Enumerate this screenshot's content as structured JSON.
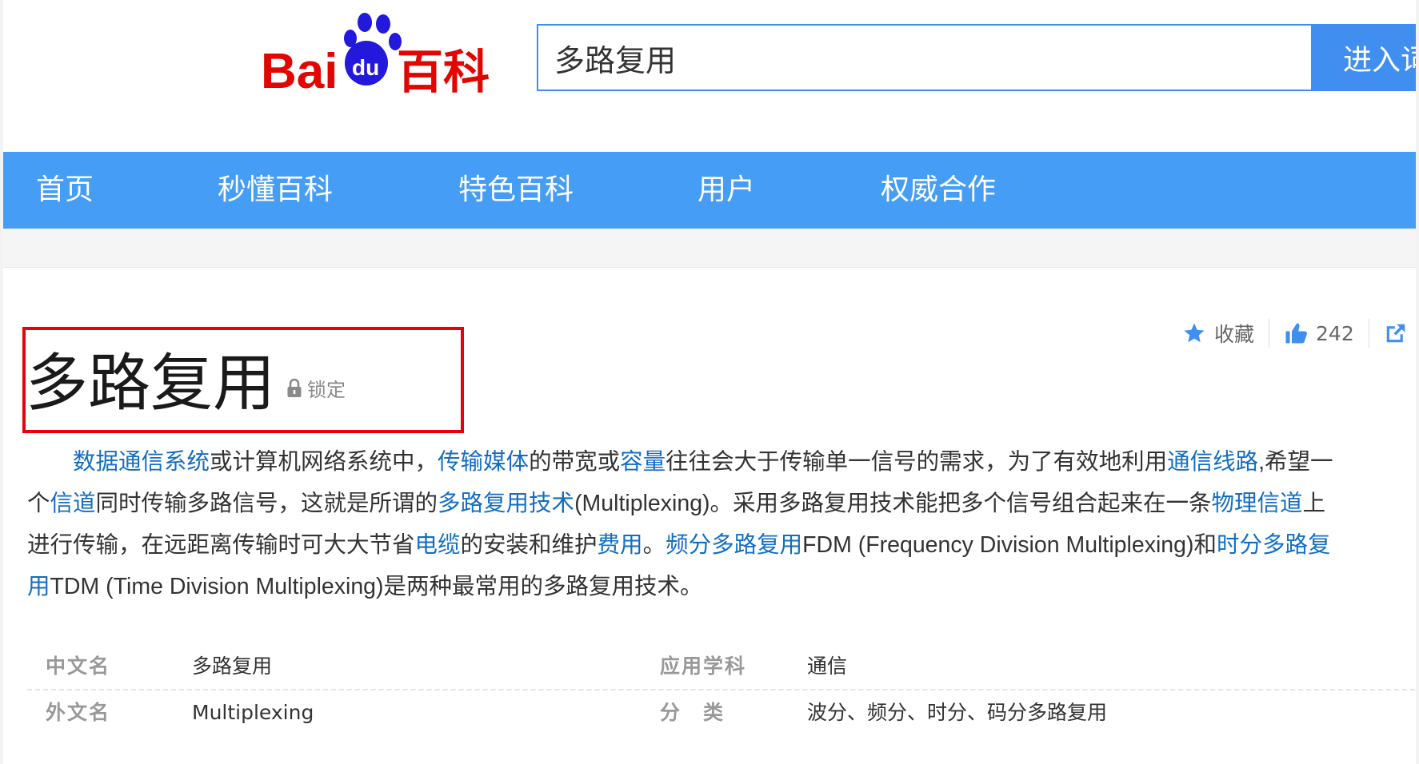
{
  "header": {
    "logo": {
      "text_bai": "Bai",
      "text_du": "du",
      "text_baike": "百科",
      "colors": {
        "red": "#e10601",
        "blue": "#2319dc"
      }
    },
    "search_value": "多路复用",
    "search_button": "进入词条"
  },
  "nav": {
    "items": [
      {
        "label": "首页"
      },
      {
        "label": "秒懂百科"
      },
      {
        "label": "特色百科"
      },
      {
        "label": "用户"
      },
      {
        "label": "权威合作"
      }
    ]
  },
  "entry": {
    "title": "多路复用",
    "lock_label": "锁定",
    "actions": {
      "favorite_label": "收藏",
      "like_count": "242"
    }
  },
  "summary": {
    "lines": [
      [
        {
          "t": "　　"
        },
        {
          "t": "数据通信系统",
          "link": true
        },
        {
          "t": "或计算机网络系统中，"
        },
        {
          "t": "传输媒体",
          "link": true
        },
        {
          "t": "的带宽或"
        },
        {
          "t": "容量",
          "link": true
        },
        {
          "t": "往往会大于传输单一信号的需求，为了有效地利用"
        },
        {
          "t": "通信线路",
          "link": true
        },
        {
          "t": ",希望一"
        }
      ],
      [
        {
          "t": "个"
        },
        {
          "t": "信道",
          "link": true
        },
        {
          "t": "同时传输多路信号，这就是所谓的"
        },
        {
          "t": "多路复用技术",
          "link": true
        },
        {
          "t": "(Multiplexing)。采用多路复用技术能把多个信号组合起来在一条"
        },
        {
          "t": "物理信道",
          "link": true
        },
        {
          "t": "上"
        }
      ],
      [
        {
          "t": "进行传输，在远距离传输时可大大节省"
        },
        {
          "t": "电缆",
          "link": true
        },
        {
          "t": "的安装和维护"
        },
        {
          "t": "费用",
          "link": true
        },
        {
          "t": "。"
        },
        {
          "t": "频分多路复用",
          "link": true
        },
        {
          "t": "FDM (Frequency Division Multiplexing)和"
        },
        {
          "t": "时分多路复",
          "link": true
        }
      ],
      [
        {
          "t": "用",
          "link": true
        },
        {
          "t": "TDM (Time Division Multiplexing)是两种最常用的多路复用技术。"
        }
      ]
    ]
  },
  "basic_info": {
    "rows": [
      {
        "l1": "中文名",
        "v1": "多路复用",
        "l2": "应用学科",
        "v2": "通信"
      },
      {
        "l1": "外文名",
        "v1": "Multiplexing",
        "l2": "分　类",
        "v2": "波分、频分、时分、码分多路复用"
      }
    ]
  },
  "colors": {
    "nav_bg": "#459df5",
    "link": "#136ec2",
    "highlight_box": "#e8000e",
    "search_border": "#3f8ef0",
    "action_blue": "#3f8ef0"
  }
}
